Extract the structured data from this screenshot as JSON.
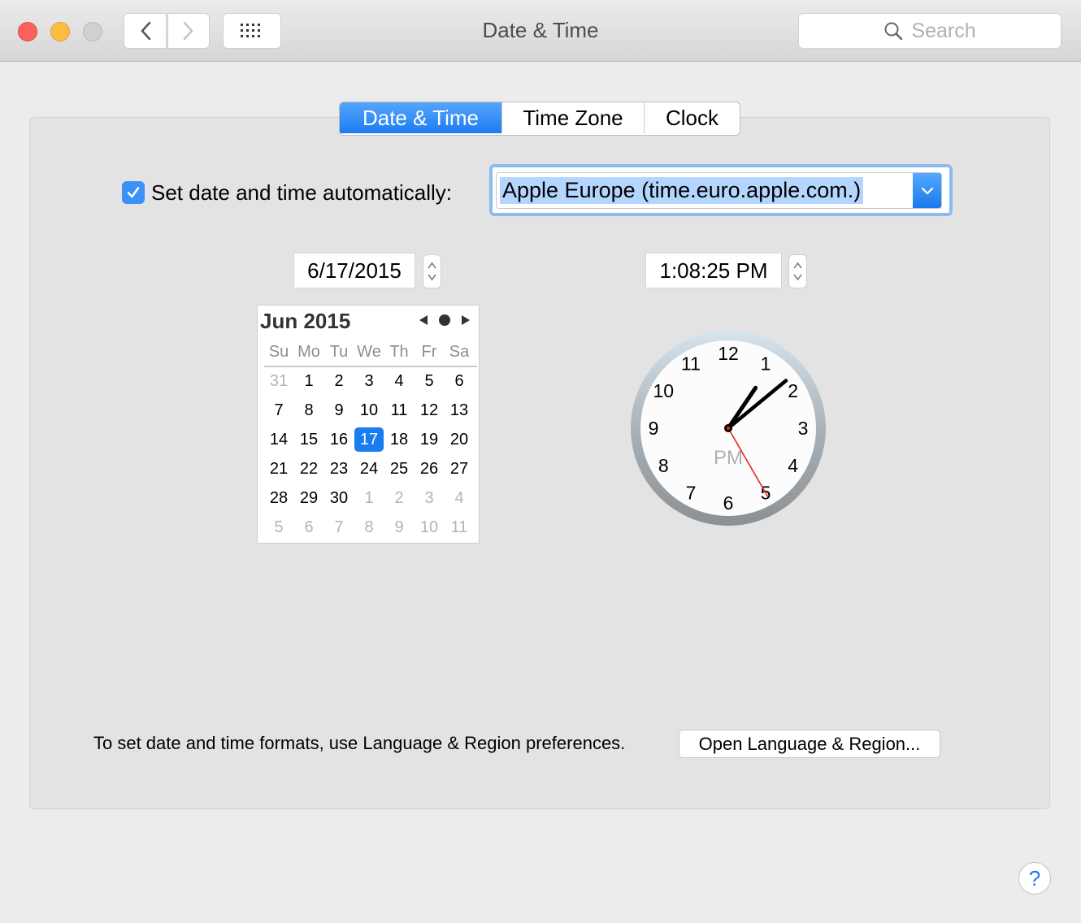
{
  "window": {
    "title": "Date & Time",
    "search_placeholder": "Search"
  },
  "tabs": [
    {
      "label": "Date & Time",
      "active": true
    },
    {
      "label": "Time Zone",
      "active": false
    },
    {
      "label": "Clock",
      "active": false
    }
  ],
  "auto": {
    "checked": true,
    "label": "Set date and time automatically:",
    "server": "Apple Europe (time.euro.apple.com.)"
  },
  "date_value": "6/17/2015",
  "time_value": "1:08:25 PM",
  "calendar": {
    "title": "Jun 2015",
    "weekdays": [
      "Su",
      "Mo",
      "Tu",
      "We",
      "Th",
      "Fr",
      "Sa"
    ],
    "weeks": [
      [
        "31",
        "1",
        "2",
        "3",
        "4",
        "5",
        "6"
      ],
      [
        "7",
        "8",
        "9",
        "10",
        "11",
        "12",
        "13"
      ],
      [
        "14",
        "15",
        "16",
        "17",
        "18",
        "19",
        "20"
      ],
      [
        "21",
        "22",
        "23",
        "24",
        "25",
        "26",
        "27"
      ],
      [
        "28",
        "29",
        "30",
        "1",
        "2",
        "3",
        "4"
      ],
      [
        "5",
        "6",
        "7",
        "8",
        "9",
        "10",
        "11"
      ]
    ],
    "selected_day": "17"
  },
  "clock": {
    "numbers": [
      "12",
      "1",
      "2",
      "3",
      "4",
      "5",
      "6",
      "7",
      "8",
      "9",
      "10",
      "11"
    ],
    "ampm": "PM",
    "hour": 1,
    "minute": 8,
    "second": 25
  },
  "footer": {
    "text": "To set date and time formats, use Language & Region preferences.",
    "button": "Open Language & Region..."
  },
  "help": "?",
  "colors": {
    "accent": "#1a7cf1",
    "close": "#fc615d",
    "minimize": "#fdbc40",
    "zoom": "#d0d0d0",
    "second_hand": "#e0261d"
  },
  "icons": [
    "back-chevron-icon",
    "forward-chevron-icon",
    "show-all-grid-icon",
    "search-icon",
    "checkmark-icon",
    "chevron-down-icon",
    "stepper-arrows-icon",
    "previous-month-icon",
    "today-dot-icon",
    "next-month-icon"
  ]
}
